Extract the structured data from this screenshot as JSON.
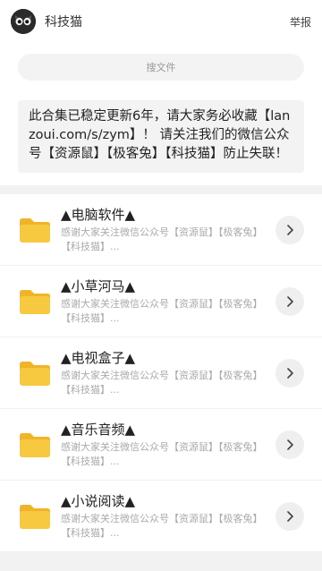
{
  "header": {
    "title": "科技猫",
    "report_label": "举报"
  },
  "search": {
    "placeholder": "搜文件"
  },
  "notice": {
    "text": "此合集已稳定更新6年，请大家务必收藏【lanzoui.com/s/zym】！ 请关注我们的微信公众号【资源鼠】【极客兔】【科技猫】防止失联！"
  },
  "folders": [
    {
      "name": "▲电脑软件▲",
      "desc": "感谢大家关注微信公众号【资源鼠】【极客兔】【科技猫】..."
    },
    {
      "name": "▲小草河马▲",
      "desc": "感谢大家关注微信公众号【资源鼠】【极客兔】【科技猫】..."
    },
    {
      "name": "▲电视盒子▲",
      "desc": "感谢大家关注微信公众号【资源鼠】【极客兔】【科技猫】..."
    },
    {
      "name": "▲音乐音频▲",
      "desc": "感谢大家关注微信公众号【资源鼠】【极客兔】【科技猫】..."
    },
    {
      "name": "▲小说阅读▲",
      "desc": "感谢大家关注微信公众号【资源鼠】【极客兔】【科技猫】..."
    }
  ],
  "icons": {
    "avatar": "cat-avatar-icon",
    "folder": "folder-icon",
    "chevron": "chevron-right-icon"
  },
  "colors": {
    "folder": "#f7c940",
    "folder_tab": "#f0b429",
    "background": "#f2f2f2"
  }
}
